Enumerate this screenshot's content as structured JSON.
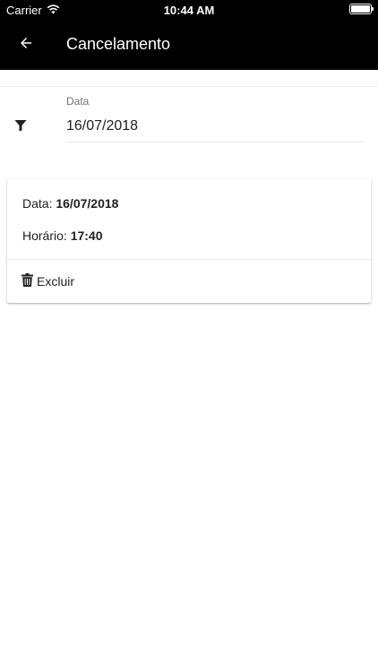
{
  "status_bar": {
    "carrier": "Carrier",
    "time": "10:44 AM"
  },
  "app_bar": {
    "title": "Cancelamento",
    "back_icon": "arrow-left-icon"
  },
  "filter": {
    "icon": "filter-icon",
    "label": "Data",
    "value": "16/07/2018"
  },
  "card": {
    "date_label": "Data:",
    "date_value": "16/07/2018",
    "time_label": "Horário:",
    "time_value": "17:40",
    "delete_label": "Excluir",
    "delete_icon": "trash-icon"
  },
  "colors": {
    "app_bar": "#000000",
    "background": "#ffffff",
    "text": "#212121",
    "label": "#757575"
  }
}
